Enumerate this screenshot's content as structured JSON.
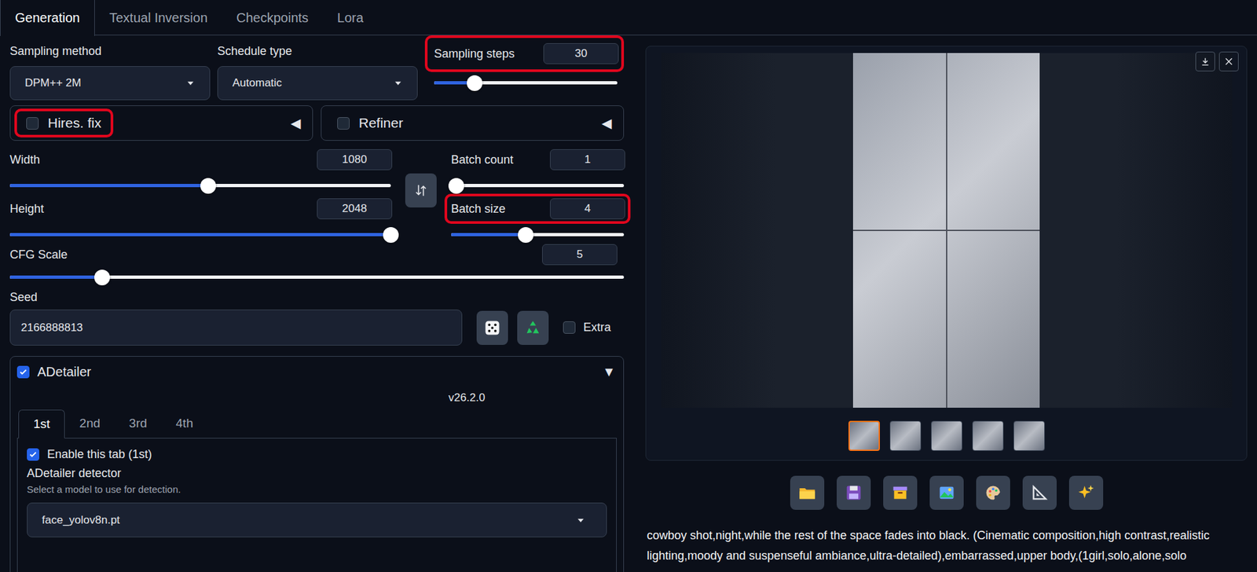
{
  "tabs": [
    {
      "label": "Generation",
      "selected": true
    },
    {
      "label": "Textual Inversion",
      "selected": false
    },
    {
      "label": "Checkpoints",
      "selected": false
    },
    {
      "label": "Lora",
      "selected": false
    }
  ],
  "sampling_method": {
    "label": "Sampling method",
    "value": "DPM++ 2M"
  },
  "schedule_type": {
    "label": "Schedule type",
    "value": "Automatic"
  },
  "sampling_steps": {
    "label": "Sampling steps",
    "value": "30",
    "level": 0.22,
    "highlighted": true
  },
  "hires_fix": {
    "label": "Hires. fix",
    "toggle": "◀",
    "checked": false,
    "highlighted": true
  },
  "refiner": {
    "label": "Refiner",
    "toggle": "◀",
    "checked": false,
    "highlighted": false
  },
  "width": {
    "label": "Width",
    "value": "1080",
    "level": 0.52,
    "highlighted": false
  },
  "height": {
    "label": "Height",
    "value": "2048",
    "level": 1,
    "highlighted": false
  },
  "batch_count": {
    "label": "Batch count",
    "value": "1",
    "level": 0.03,
    "highlighted": false
  },
  "batch_size": {
    "label": "Batch size",
    "value": "4",
    "level": 0.43,
    "highlighted": true
  },
  "cfg_scale": {
    "label": "CFG Scale",
    "value": "5",
    "level": 0.15
  },
  "seed": {
    "label": "Seed",
    "value": "2166888813",
    "extra": {
      "label": "Extra",
      "checked": false
    }
  },
  "adetailer": {
    "label": "ADetailer",
    "toggle": "▼",
    "checked": true,
    "version": "v26.2.0",
    "tabs": [
      {
        "label": "1st",
        "selected": true
      },
      {
        "label": "2nd",
        "selected": false
      },
      {
        "label": "3rd",
        "selected": false
      },
      {
        "label": "4th",
        "selected": false
      }
    ],
    "enable": {
      "label": "Enable this tab (1st)",
      "checked": true
    },
    "detector": {
      "label": "ADetailer detector",
      "hint": "Select a model to use for detection.",
      "value": "face_yolov8n.pt"
    }
  },
  "gallery": {
    "thumbnails": [
      {
        "selected": true
      },
      {
        "selected": false
      },
      {
        "selected": false
      },
      {
        "selected": false
      },
      {
        "selected": false
      }
    ],
    "prompt_lines": [
      "cowboy shot,night,while the rest of the space fades into black. (Cinematic composition,high contrast,realistic",
      "lighting,moody and suspenseful ambiance,ultra-detailed),embarrassed,upper body,(1girl,solo,alone,solo"
    ]
  }
}
